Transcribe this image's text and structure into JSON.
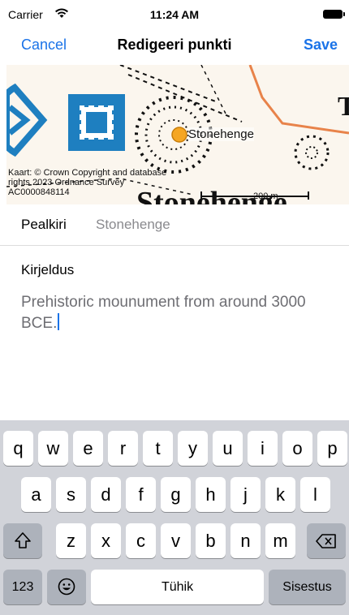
{
  "status_bar": {
    "carrier": "Carrier",
    "time": "11:24 AM"
  },
  "nav": {
    "cancel": "Cancel",
    "title": "Redigeeri punkti",
    "save": "Save"
  },
  "map": {
    "poi_label": "Stonehenge",
    "copyright": "Kaart: © Crown Copyright and database rights 2023 Ordnance Survey AC0000848114",
    "scale": "200 m",
    "map_text": "Stonehenge",
    "marker_color": "#f5a623"
  },
  "form": {
    "title_label": "Pealkiri",
    "title_value": "Stonehenge",
    "description_label": "Kirjeldus",
    "description_value": "Prehistoric mounument from around 3000 BCE."
  },
  "keyboard": {
    "row1": [
      "q",
      "w",
      "e",
      "r",
      "t",
      "y",
      "u",
      "i",
      "o",
      "p"
    ],
    "row2": [
      "a",
      "s",
      "d",
      "f",
      "g",
      "h",
      "j",
      "k",
      "l"
    ],
    "row3": [
      "z",
      "x",
      "c",
      "v",
      "b",
      "n",
      "m"
    ],
    "numbers": "123",
    "space": "Tühik",
    "return": "Sisestus"
  },
  "colors": {
    "accent": "#1a73e8",
    "keyboard_bg": "#d1d3d9"
  }
}
